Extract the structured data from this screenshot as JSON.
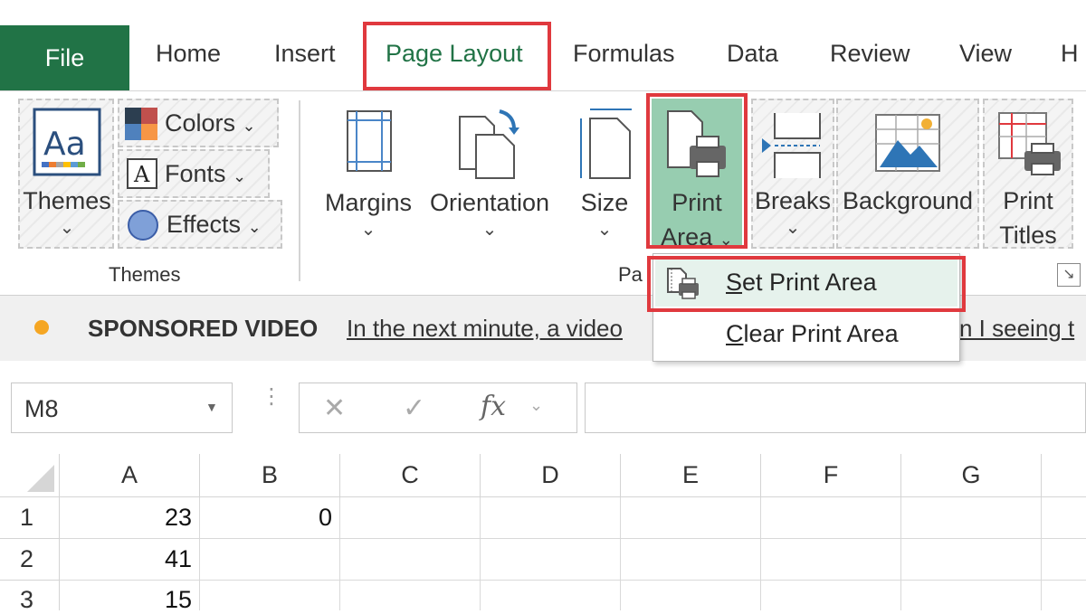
{
  "tabs": {
    "file": "File",
    "home": "Home",
    "insert": "Insert",
    "page_layout": "Page Layout",
    "formulas": "Formulas",
    "data": "Data",
    "review": "Review",
    "view": "View",
    "more": "H"
  },
  "ribbon": {
    "themes_button": {
      "line1": "Themes",
      "chevron": "⌄"
    },
    "colors": "Colors",
    "fonts": "Fonts",
    "effects": "Effects",
    "themes_group": "Themes",
    "margins": "Margins",
    "orientation": "Orientation",
    "size": "Size",
    "print_area_line1": "Print",
    "print_area_line2": "Area",
    "breaks": "Breaks",
    "background": "Background",
    "print_titles_line1": "Print",
    "print_titles_line2": "Titles",
    "page_setup_group": "Pa",
    "chevron": "⌄"
  },
  "dropdown": {
    "set_print_area_key": "S",
    "set_print_area_rest": "et Print Area",
    "clear_print_area_key": "C",
    "clear_print_area_rest": "lear Print Area"
  },
  "sponsor": {
    "label": "SPONSORED VIDEO",
    "link1": "In the next minute, a video",
    "link2": "n I seeing t"
  },
  "formula_bar": {
    "name_box": "M8",
    "cancel": "✕",
    "enter": "✓",
    "fx": "fx",
    "value": ""
  },
  "grid": {
    "columns": [
      "A",
      "B",
      "C",
      "D",
      "E",
      "F",
      "G"
    ],
    "rows": [
      {
        "num": "1",
        "A": "23",
        "B": "0"
      },
      {
        "num": "2",
        "A": "41",
        "B": ""
      },
      {
        "num": "3",
        "A": "15",
        "B": ""
      }
    ]
  },
  "colors": {
    "excel_green": "#217346",
    "highlight_red": "#e0393e",
    "selected_button": "#97cdb0",
    "sponsor_dot": "#f5a623"
  }
}
